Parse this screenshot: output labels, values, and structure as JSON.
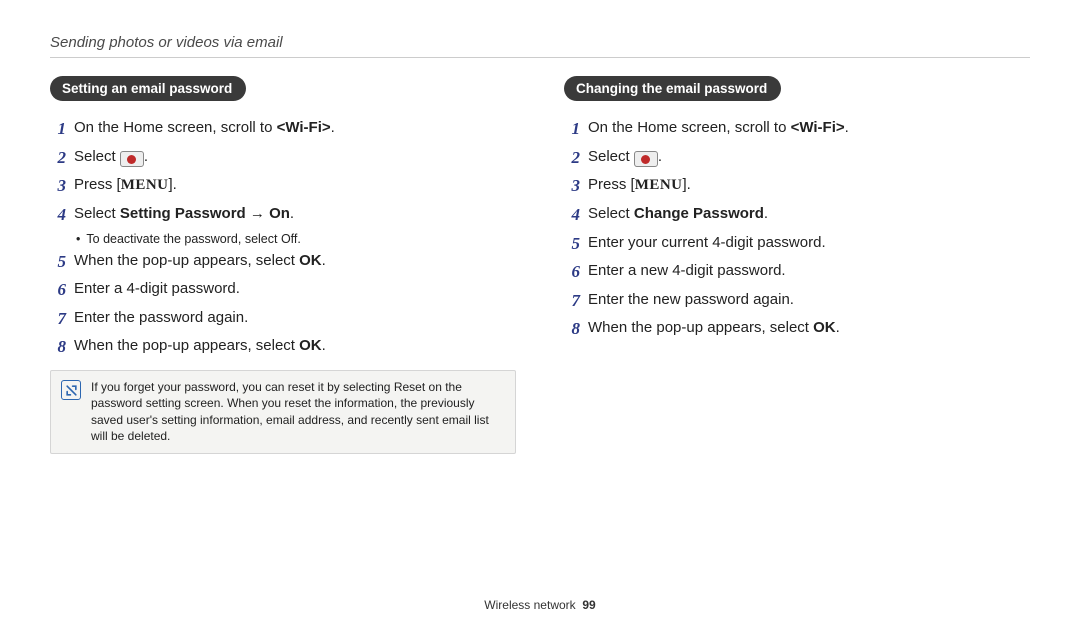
{
  "topline": "Sending photos or videos via email",
  "left": {
    "heading": "Setting an email password",
    "steps": [
      {
        "n": "1",
        "parts": [
          {
            "t": "On the Home screen, scroll to "
          },
          {
            "t": "<Wi-Fi>",
            "bold": true
          },
          {
            "t": "."
          }
        ]
      },
      {
        "n": "2",
        "parts": [
          {
            "t": "Select "
          },
          {
            "icon": "select-icon"
          },
          {
            "t": "."
          }
        ]
      },
      {
        "n": "3",
        "parts": [
          {
            "t": "Press ["
          },
          {
            "t": "MENU",
            "menu": true
          },
          {
            "t": "]."
          }
        ]
      },
      {
        "n": "4",
        "parts": [
          {
            "t": "Select "
          },
          {
            "t": "Setting Password",
            "bold": true
          },
          {
            "t": " → "
          },
          {
            "t": "On",
            "bold": true
          },
          {
            "t": "."
          }
        ],
        "sub": [
          {
            "t": "To deactivate the password, select "
          },
          {
            "t": "Off",
            "bold": true
          },
          {
            "t": "."
          }
        ]
      },
      {
        "n": "5",
        "parts": [
          {
            "t": "When the pop-up appears, select "
          },
          {
            "t": "OK",
            "bold": true
          },
          {
            "t": "."
          }
        ]
      },
      {
        "n": "6",
        "parts": [
          {
            "t": "Enter a 4-digit password."
          }
        ]
      },
      {
        "n": "7",
        "parts": [
          {
            "t": "Enter the password again."
          }
        ]
      },
      {
        "n": "8",
        "parts": [
          {
            "t": "When the pop-up appears, select "
          },
          {
            "t": "OK",
            "bold": true
          },
          {
            "t": "."
          }
        ]
      }
    ],
    "note": [
      {
        "t": "If you forget your password, you can reset it by selecting "
      },
      {
        "t": "Reset",
        "bold": true
      },
      {
        "t": " on the password setting screen. When you reset the information, the previously saved user's setting information, email address, and recently sent email list will be deleted."
      }
    ]
  },
  "right": {
    "heading": "Changing the email password",
    "steps": [
      {
        "n": "1",
        "parts": [
          {
            "t": "On the Home screen, scroll to "
          },
          {
            "t": "<Wi-Fi>",
            "bold": true
          },
          {
            "t": "."
          }
        ]
      },
      {
        "n": "2",
        "parts": [
          {
            "t": "Select "
          },
          {
            "icon": "select-icon"
          },
          {
            "t": "."
          }
        ]
      },
      {
        "n": "3",
        "parts": [
          {
            "t": "Press ["
          },
          {
            "t": "MENU",
            "menu": true
          },
          {
            "t": "]."
          }
        ]
      },
      {
        "n": "4",
        "parts": [
          {
            "t": "Select "
          },
          {
            "t": "Change Password",
            "bold": true
          },
          {
            "t": "."
          }
        ]
      },
      {
        "n": "5",
        "parts": [
          {
            "t": "Enter your current 4-digit password."
          }
        ]
      },
      {
        "n": "6",
        "parts": [
          {
            "t": "Enter a new 4-digit password."
          }
        ]
      },
      {
        "n": "7",
        "parts": [
          {
            "t": "Enter the new password again."
          }
        ]
      },
      {
        "n": "8",
        "parts": [
          {
            "t": "When the pop-up appears, select "
          },
          {
            "t": "OK",
            "bold": true
          },
          {
            "t": "."
          }
        ]
      }
    ]
  },
  "footer": {
    "section": "Wireless network",
    "page": "99"
  }
}
